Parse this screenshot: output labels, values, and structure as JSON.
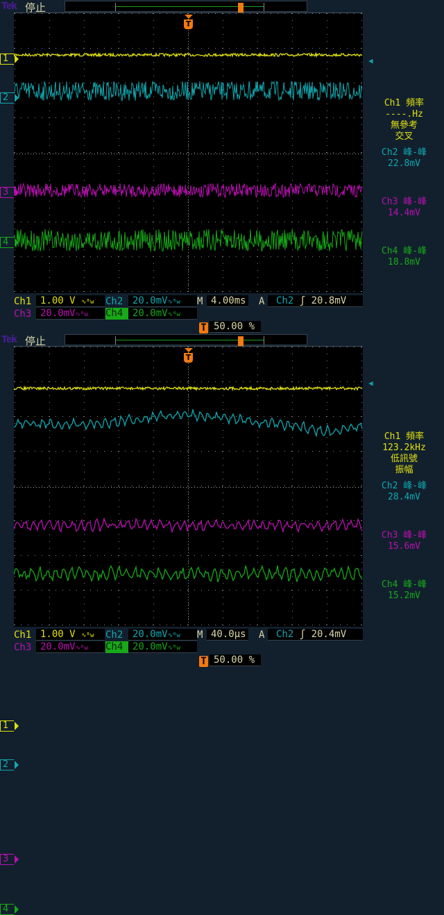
{
  "colors": {
    "ch1": "#e0e010",
    "ch2": "#10a8b0",
    "ch3": "#b810b0",
    "ch4": "#18a818",
    "trigger": "#f27a10"
  },
  "panels": [
    {
      "brand": "Tek",
      "state": "停止",
      "trigger_marker": "T",
      "channel_markers": [
        "1",
        "2",
        "3",
        "4"
      ],
      "status": {
        "ch1_label": "Ch1",
        "ch1_scale": "1.00 V",
        "ch2_label": "Ch2",
        "ch2_scale": "20.0mV",
        "ch3_label": "Ch3",
        "ch3_scale": "20.0mV",
        "ch4_label": "Ch4",
        "ch4_scale": "20.0mV",
        "bw": "∿ᴮw",
        "timebase_label": "M",
        "timebase": "4.00ms",
        "trigger_mode": "A",
        "trigger_source": "Ch2",
        "trigger_slope": "ʃ",
        "trigger_level": "20.8mV",
        "trigger_pos_icon": "T",
        "trigger_pos": "50.00 %"
      },
      "measurements": {
        "ch1": {
          "title": "Ch1 頻率",
          "value": "----.Hz",
          "note1": "無參考",
          "note2": "交叉"
        },
        "ch2": {
          "title": "Ch2 峰-峰",
          "value": "22.8mV"
        },
        "ch3": {
          "title": "Ch3 峰-峰",
          "value": "14.4mV"
        },
        "ch4": {
          "title": "Ch4 峰-峰",
          "value": "18.8mV"
        }
      }
    },
    {
      "brand": "Tek",
      "state": "停止",
      "trigger_marker": "T",
      "channel_markers": [
        "1",
        "2",
        "3",
        "4"
      ],
      "status": {
        "ch1_label": "Ch1",
        "ch1_scale": "1.00 V",
        "ch2_label": "Ch2",
        "ch2_scale": "20.0mV",
        "ch3_label": "Ch3",
        "ch3_scale": "20.0mV",
        "ch4_label": "Ch4",
        "ch4_scale": "20.0mV",
        "bw": "∿ᴮw",
        "timebase_label": "M",
        "timebase": "40.0µs",
        "trigger_mode": "A",
        "trigger_source": "Ch2",
        "trigger_slope": "ʃ",
        "trigger_level": "20.4mV",
        "trigger_pos_icon": "T",
        "trigger_pos": "50.00 %"
      },
      "measurements": {
        "ch1": {
          "title": "Ch1 頻率",
          "value": "123.2kHz",
          "note1": "低訊號",
          "note2": "振幅"
        },
        "ch2": {
          "title": "Ch2 峰-峰",
          "value": "28.4mV"
        },
        "ch3": {
          "title": "Ch3 峰-峰",
          "value": "15.6mV"
        },
        "ch4": {
          "title": "Ch4 峰-峰",
          "value": "15.2mV"
        }
      }
    }
  ]
}
